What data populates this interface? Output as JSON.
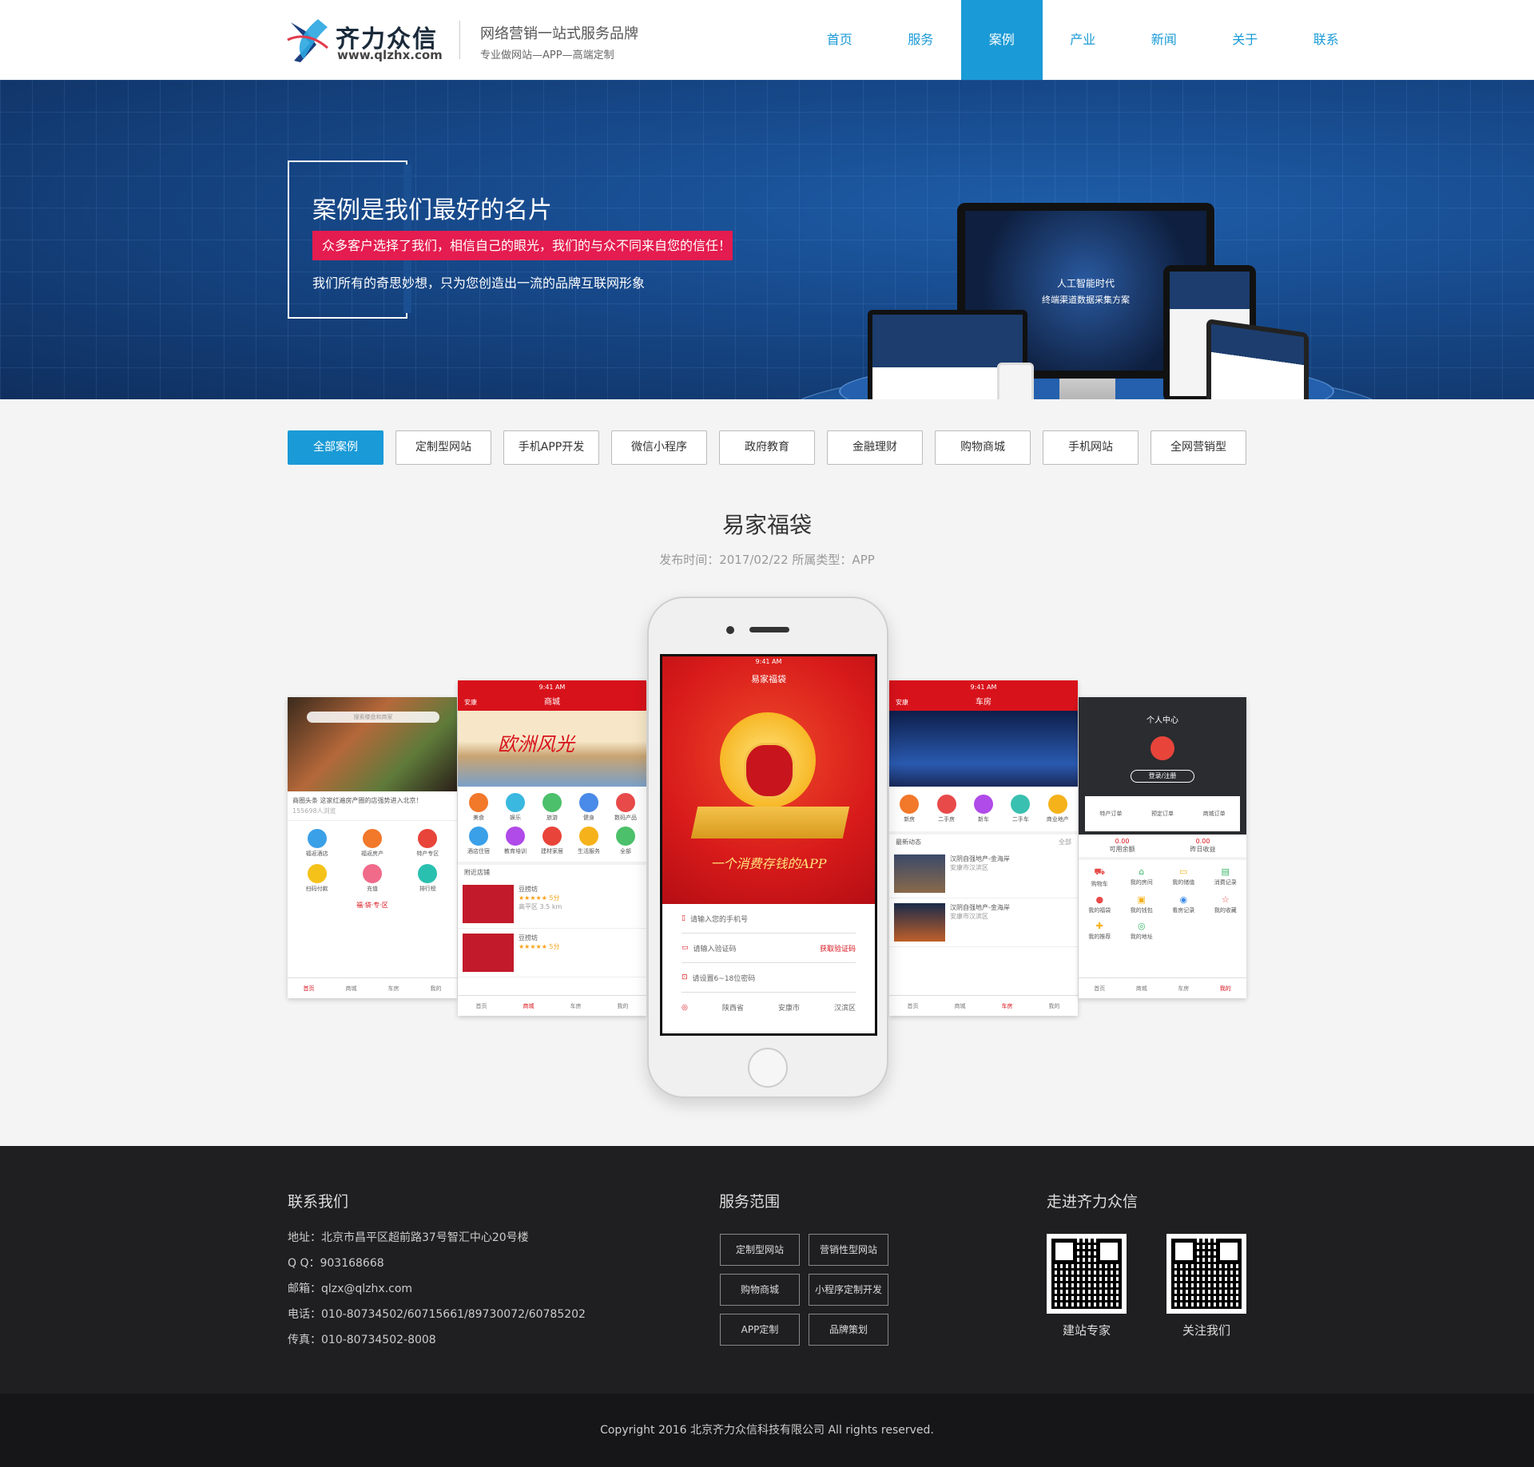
{
  "brand": {
    "name": "齐力众信",
    "url": "www.qlzhx.com",
    "slogan": "网络营销一站式服务品牌",
    "sub_slogan": "专业做网站—APP—高端定制"
  },
  "nav": {
    "items": [
      {
        "label": "首页",
        "active": false
      },
      {
        "label": "服务",
        "active": false
      },
      {
        "label": "案例",
        "active": true
      },
      {
        "label": "产业",
        "active": false
      },
      {
        "label": "新闻",
        "active": false
      },
      {
        "label": "关于",
        "active": false
      },
      {
        "label": "联系",
        "active": false
      }
    ]
  },
  "banner": {
    "title": "案例是我们最好的名片",
    "tagline": "众多客户选择了我们，相信自己的眼光，我们的与众不同来自您的信任！",
    "subtitle": "我们所有的奇思妙想，只为您创造出一流的品牌互联网形象",
    "screen_line1": "人工智能时代",
    "screen_line2": "终端渠道数据采集方案"
  },
  "filters": [
    {
      "label": "全部案例",
      "active": true
    },
    {
      "label": "定制型网站",
      "active": false
    },
    {
      "label": "手机APP开发",
      "active": false
    },
    {
      "label": "微信小程序",
      "active": false
    },
    {
      "label": "政府教育",
      "active": false
    },
    {
      "label": "金融理财",
      "active": false
    },
    {
      "label": "购物商城",
      "active": false
    },
    {
      "label": "手机网站",
      "active": false
    },
    {
      "label": "全网营销型",
      "active": false
    }
  ],
  "case": {
    "title": "易家福袋",
    "meta": "发布时间：2017/02/22 所属类型：APP"
  },
  "phones": {
    "time": "9:41 AM",
    "center": {
      "app_title": "易家福袋",
      "slogan": "一个消费存钱的APP",
      "phone_placeholder": "请输入您的手机号",
      "code_placeholder": "请输入验证码",
      "get_code": "获取验证码",
      "password_placeholder": "请设置6~18位密码",
      "province": "陕西省",
      "city": "安康市",
      "district": "汉滨区"
    },
    "mall": {
      "title": "商城",
      "location": "安康",
      "banner_text": "欧洲风光",
      "categories": [
        "美食",
        "娱乐",
        "旅游",
        "健身",
        "数码产品",
        "酒店住宿",
        "教育培训",
        "建材家居",
        "生活服务",
        "全部"
      ],
      "nearby": "附近店铺",
      "shop_name": "豆捞坊",
      "shop_rating": "5分",
      "shop_area": "高平区",
      "shop_distance": "3.5 km",
      "tabs": [
        "首页",
        "商城",
        "车房",
        "我的"
      ]
    },
    "home": {
      "search": "搜索楼盘和商家",
      "headline": "商圈头条  这家红遍房产圈的店强势进入北京！",
      "views": "155698人浏览",
      "items": [
        "福返酒店",
        "福返房产",
        "特产专区",
        "扫码付款",
        "充值",
        "排行榜"
      ],
      "badge": "福·袋·专·区",
      "tabs": [
        "首页",
        "商城",
        "车房",
        "我的"
      ]
    },
    "estate": {
      "title": "车房",
      "location": "安康",
      "icons": [
        "新房",
        "二手房",
        "新车",
        "二手车",
        "商业地产"
      ],
      "news_title": "最新动态",
      "news_all": "全部",
      "news_item": "汉阴自强地产-金海岸",
      "news_loc": "安康市汉滨区",
      "tabs": [
        "首页",
        "商城",
        "车房",
        "我的"
      ]
    },
    "profile": {
      "title": "个人中心",
      "login": "登录/注册",
      "orders": [
        "特产订单",
        "预定订单",
        "商城订单"
      ],
      "balance": "0.00",
      "balance_label": "可用余额",
      "income": "0.00",
      "income_label": "昨日收益",
      "menu": [
        "购物车",
        "我的房间",
        "我的储值",
        "消费记录",
        "我的福袋",
        "我的钱包",
        "看房记录",
        "我的收藏",
        "我的推荐",
        "我的地址"
      ],
      "tabs": [
        "首页",
        "商城",
        "车房",
        "我的"
      ]
    }
  },
  "footer": {
    "contact_title": "联系我们",
    "contact_lines": [
      "地址：北京市昌平区超前路37号智汇中心20号楼",
      "Q Q：903168668",
      "邮箱：qlzx@qlzhx.com",
      "电话：010-80734502/60715661/89730072/60785202",
      "传真：010-80734502-8008"
    ],
    "service_title": "服务范围",
    "services": [
      "定制型网站",
      "营销性型网站",
      "购物商城",
      "小程序定制开发",
      "APP定制",
      "品牌策划"
    ],
    "about_title": "走进齐力众信",
    "qr_labels": [
      "建站专家",
      "关注我们"
    ],
    "copyright": "Copyright 2016 北京齐力众信科技有限公司 All rights reserved."
  },
  "colors": {
    "primary": "#1a9ad6",
    "accent_red": "#e41c4f",
    "app_red": "#d8121b",
    "footer_bg": "#1f1f21"
  }
}
